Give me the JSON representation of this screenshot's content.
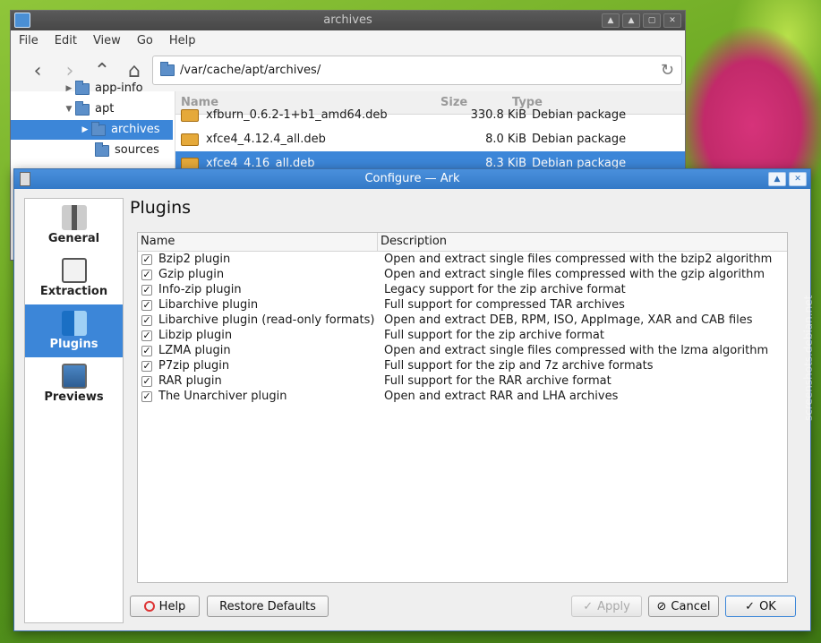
{
  "file_manager": {
    "title": "archives",
    "menu": [
      "File",
      "Edit",
      "View",
      "Go",
      "Help"
    ],
    "location": "/var/cache/apt/archives/",
    "tree": [
      {
        "label": "app-info",
        "arrow": "▶"
      },
      {
        "label": "apt",
        "arrow": "▼"
      },
      {
        "label": "archives",
        "arrow": "▶"
      },
      {
        "label": "sources",
        "arrow": ""
      }
    ],
    "columns": {
      "name": "Name",
      "size": "Size",
      "type": "Type"
    },
    "files": [
      {
        "name": "xfburn_0.6.2-1+b1_amd64.deb",
        "size": "330.8 KiB",
        "type": "Debian package"
      },
      {
        "name": "xfce4_4.12.4_all.deb",
        "size": "8.0 KiB",
        "type": "Debian package"
      },
      {
        "name": "xfce4_4.16_all.deb",
        "size": "8.3 KiB",
        "type": "Debian package"
      }
    ]
  },
  "dialog": {
    "title": "Configure — Ark",
    "sidebar": [
      {
        "label": "General",
        "icon": "zip-archive-icon"
      },
      {
        "label": "Extraction",
        "icon": "extraction-icon"
      },
      {
        "label": "Plugins",
        "icon": "plugins-icon"
      },
      {
        "label": "Previews",
        "icon": "previews-icon"
      }
    ],
    "selected_page": "Plugins",
    "page_title": "Plugins",
    "table": {
      "col_name": "Name",
      "col_description": "Description",
      "rows": [
        {
          "name": "Bzip2 plugin",
          "description": "Open and extract single files compressed with the bzip2 algorithm",
          "checked": true
        },
        {
          "name": "Gzip plugin",
          "description": "Open and extract single files compressed with the gzip algorithm",
          "checked": true
        },
        {
          "name": "Info-zip plugin",
          "description": "Legacy support for the zip archive format",
          "checked": true
        },
        {
          "name": "Libarchive plugin",
          "description": "Full support for compressed TAR archives",
          "checked": true
        },
        {
          "name": "Libarchive plugin (read-only formats)",
          "description": "Open and extract DEB, RPM, ISO, AppImage, XAR and CAB files",
          "checked": true
        },
        {
          "name": "Libzip plugin",
          "description": "Full support for the zip archive format",
          "checked": true
        },
        {
          "name": "LZMA plugin",
          "description": "Open and extract single files compressed with the lzma algorithm",
          "checked": true
        },
        {
          "name": "P7zip plugin",
          "description": "Full support for the zip and 7z archive formats",
          "checked": true
        },
        {
          "name": "RAR plugin",
          "description": "Full support for the RAR archive format",
          "checked": true
        },
        {
          "name": "The Unarchiver plugin",
          "description": "Open and extract RAR and LHA archives",
          "checked": true
        }
      ]
    },
    "buttons": {
      "help": "Help",
      "restore_defaults": "Restore Defaults",
      "apply": "Apply",
      "cancel": "Cancel",
      "ok": "OK"
    }
  },
  "watermark": "screenshots.debian.net",
  "colors": {
    "selection": "#3c86d8",
    "titlebar_active": "#3379c7",
    "titlebar_inactive": "#474747"
  }
}
